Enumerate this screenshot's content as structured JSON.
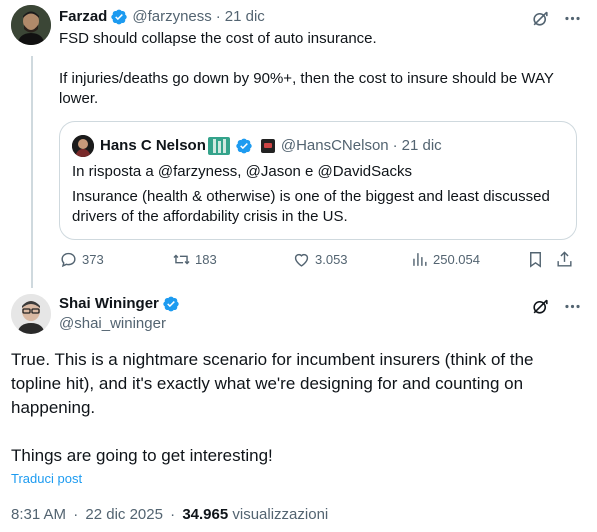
{
  "parent_post": {
    "author_name": "Farzad",
    "handle": "@farzyness",
    "dot": "·",
    "date": "21 dic",
    "text_1": "FSD should collapse the cost of auto insurance.",
    "text_2": "If injuries/deaths go down by 90%+, then the cost to insure should be WAY lower.",
    "quote": {
      "author_name": "Hans C Nelson",
      "handle": "@HansCNelson",
      "dot": "·",
      "date": "21 dic",
      "reply_to": "In risposta a @farzyness, @Jason e @DavidSacks",
      "text": "Insurance (health & otherwise) is one of the biggest and least discussed drivers of the affordability crisis in the US."
    },
    "stats": {
      "replies": "373",
      "reposts": "183",
      "likes": "3.053",
      "views": "250.054"
    }
  },
  "main_post": {
    "author_name": "Shai Wininger",
    "handle": "@shai_wininger",
    "text_1": "True. This is a nightmare scenario for incumbent insurers (think of the topline hit), and it's exactly what we're designing for and counting on happening.",
    "text_2": "Things are going to get interesting!",
    "translate_label": "Traduci post",
    "time": "8:31 AM",
    "dot": "·",
    "date": "22 dic 2025",
    "views_count": "34.965",
    "views_label": "visualizzazioni"
  },
  "colors": {
    "accent": "#1d9bf0",
    "muted": "#536471",
    "border": "#cfd9de"
  },
  "icons": [
    "verified-badge-icon",
    "grok-icon",
    "more-icon",
    "reply-icon",
    "repost-icon",
    "like-icon",
    "views-icon",
    "bookmark-icon",
    "share-icon"
  ]
}
